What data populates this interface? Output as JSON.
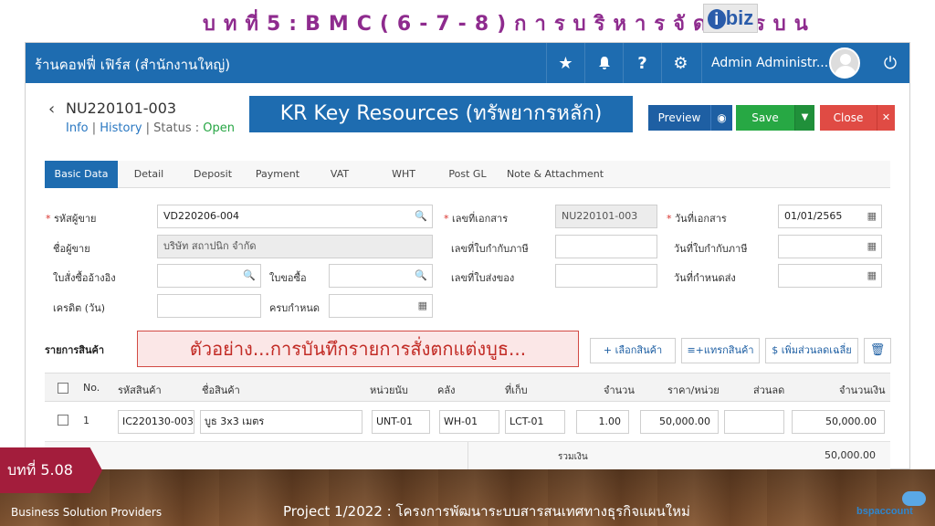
{
  "slide": {
    "title": "บทที่5:BMC(6-7-8)การบริหารจัดการบน",
    "logo": "ibiz",
    "chapter": "บทที่ 5.08",
    "footer_left": "Business Solution Providers",
    "footer_center": "Project 1/2022 : โครงการพัฒนาระบบสารสนเทศทางธุรกิจแผนใหม่",
    "footer_logo": "bspaccount"
  },
  "topbar": {
    "title": "ร้านคอฟฟี่ เฟิร์ส (สำนักงานใหญ่)",
    "user": "Admin Administr..."
  },
  "doc": {
    "number": "NU220101-003",
    "info": "Info",
    "history": "History",
    "status_label": "Status :",
    "status": "Open",
    "banner": "KR Key Resources (ทรัพยากรหลัก)",
    "preview": "Preview",
    "save": "Save",
    "close": "Close"
  },
  "tabs": [
    "Basic Data",
    "Detail",
    "Deposit",
    "Payment",
    "VAT",
    "WHT",
    "Post GL",
    "Note & Attachment"
  ],
  "form": {
    "vendor_code_label": "รหัสผู้ขาย",
    "vendor_code": "VD220206-004",
    "vendor_name_label": "ชื่อผู้ขาย",
    "vendor_name": "บริษัท สถาปนิก จำกัด",
    "po_ref_label": "ใบสั่งซื้ออ้างอิง",
    "pr_label": "ใบขอซื้อ",
    "credit_label": "เครดิต (วัน)",
    "due_label": "ครบกำหนด",
    "doc_no_label": "เลขที่เอกสาร",
    "doc_no": "NU220101-003",
    "tax_inv_no_label": "เลขที่ใบกำกับภาษี",
    "delivery_no_label": "เลขที่ใบส่งของ",
    "doc_date_label": "วันที่เอกสาร",
    "doc_date": "01/01/2565",
    "tax_inv_date_label": "วันที่ใบกำกับภาษี",
    "delivery_date_label": "วันที่กำหนดส่ง"
  },
  "items": {
    "section_label": "รายการสินค้า",
    "callout": "ตัวอย่าง...การบันทึกรายการสั่งตกแต่งบูธ...",
    "select_btn": "+ เลือกสินค้า",
    "insert_btn": "≡+แทรกสินค้า",
    "discount_btn": "$ เพิ่มส่วนลดเฉลี่ย",
    "headers": [
      "No.",
      "รหัสสินค้า",
      "ชื่อสินค้า",
      "หน่วยนับ",
      "คลัง",
      "ที่เก็บ",
      "จำนวน",
      "ราคา/หน่วย",
      "ส่วนลด",
      "จำนวนเงิน"
    ],
    "rows": [
      {
        "no": "1",
        "code": "IC220130-003",
        "name": "บูธ 3x3 เมตร",
        "unit": "UNT-01",
        "wh": "WH-01",
        "loc": "LCT-01",
        "qty": "1.00",
        "price": "50,000.00",
        "disc": "",
        "amount": "50,000.00"
      }
    ],
    "total_label": "รวมเงิน",
    "total": "50,000.00"
  }
}
